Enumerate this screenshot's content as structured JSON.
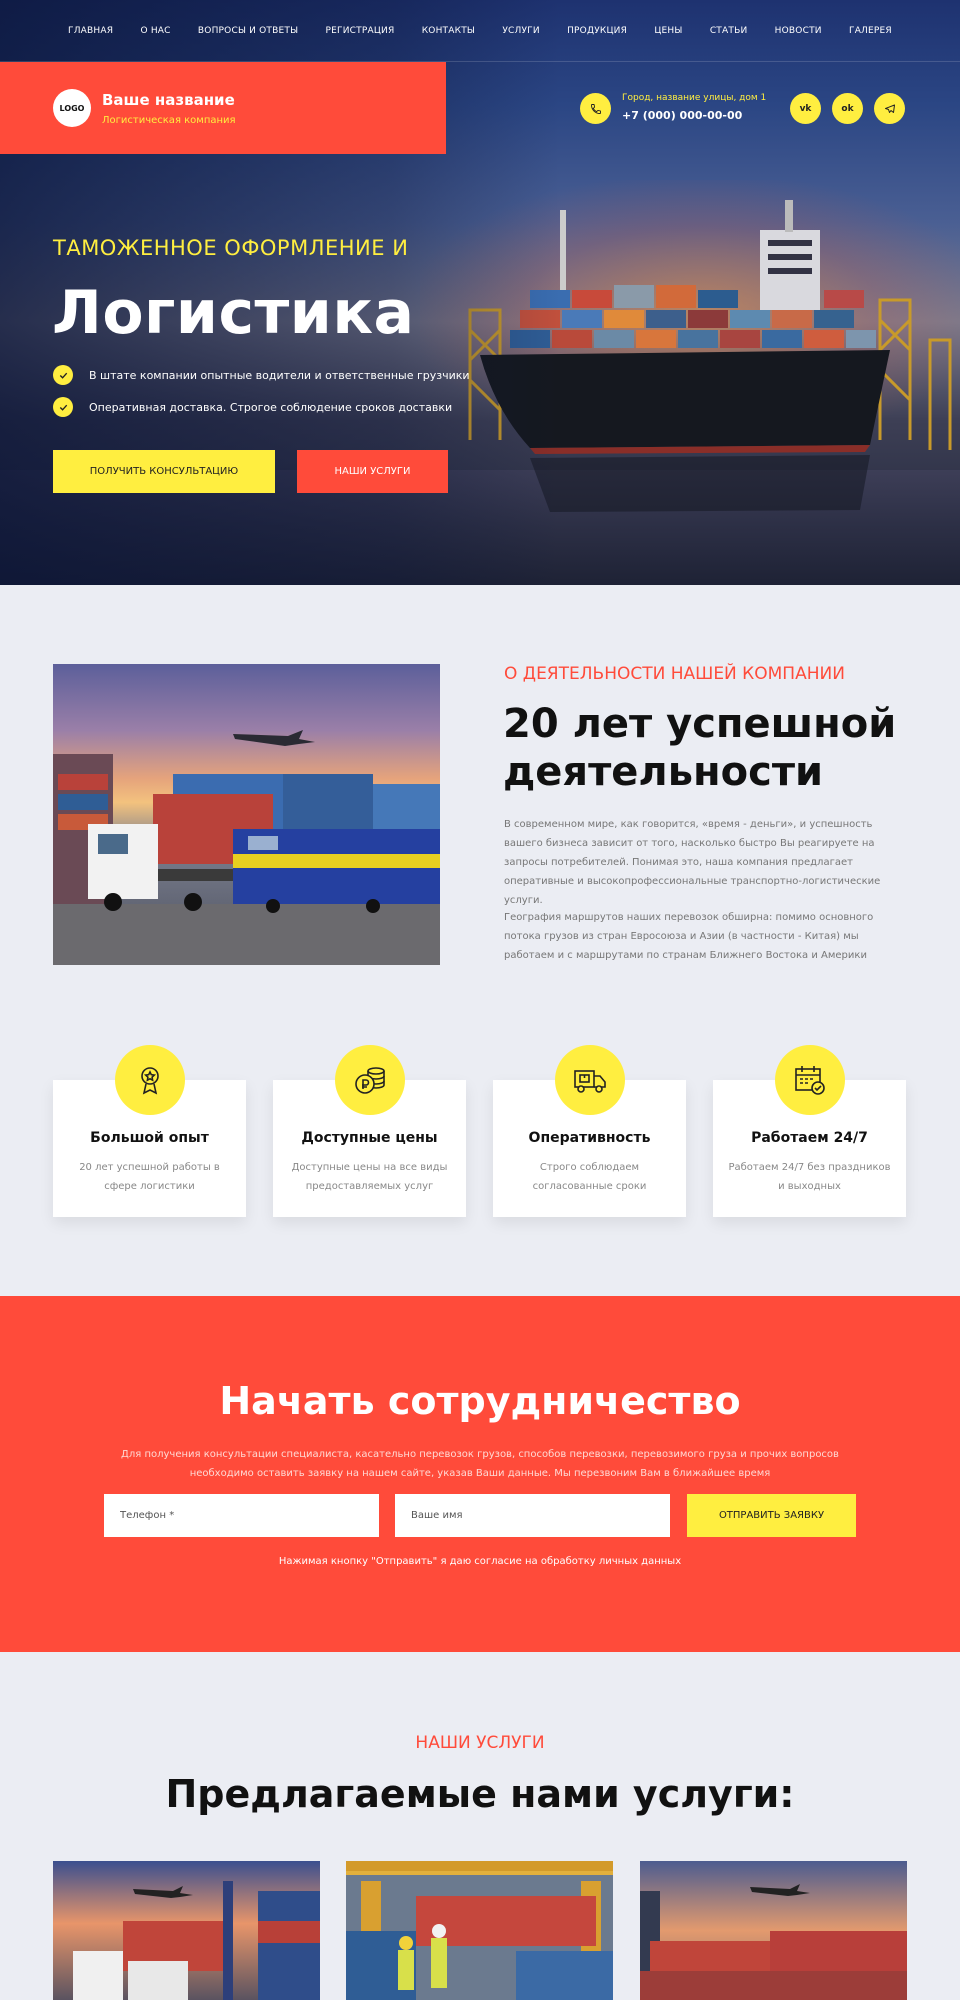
{
  "nav": {
    "items": [
      "ГЛАВНАЯ",
      "О НАС",
      "ВОПРОСЫ И ОТВЕТЫ",
      "РЕГИСТРАЦИЯ",
      "КОНТАКТЫ",
      "УСЛУГИ",
      "ПРОДУКЦИЯ",
      "ЦЕНЫ",
      "СТАТЬИ",
      "НОВОСТИ",
      "ГАЛЕРЕЯ"
    ]
  },
  "brand": {
    "logo": "LOGO",
    "name": "Ваше название",
    "subtitle": "Логистическая компания"
  },
  "contact": {
    "address": "Город, название улицы, дом 1",
    "phone": "+7 (000) 000-00-00",
    "phone_icon": "phone-icon",
    "social": [
      {
        "icon": "vk-icon",
        "glyph": "vk"
      },
      {
        "icon": "odnoklassniki-icon",
        "glyph": "ok"
      },
      {
        "icon": "telegram-icon",
        "glyph": "tg"
      }
    ]
  },
  "hero": {
    "kicker": "ТАМОЖЕННОЕ ОФОРМЛЕНИЕ И",
    "title": "Логистика",
    "bullets": [
      "В штате компании опытные водители и ответственные грузчики",
      "Оперативная доставка. Строгое соблюдение сроков доставки"
    ],
    "btn_consult": "ПОЛУЧИТЬ КОНСУЛЬТАЦИЮ",
    "btn_services": "НАШИ УСЛУГИ"
  },
  "about": {
    "kicker": "О ДЕЯТЕЛЬНОСТИ НАШЕЙ КОМПАНИИ",
    "title": "20 лет успешной деятельности",
    "p1": "В современном мире, как говорится, «время - деньги», и успешность вашего бизнеса зависит от того, насколько быстро Вы реагируете на запросы потребителей. Понимая это, наша компания предлагает оперативные и высокопрофессиональные транспортно-логистические услуги.",
    "p2": "География маршрутов наших перевозок обширна: помимо основного потока грузов из стран Евросоюза и Азии (в частности - Китая) мы работаем и с маршрутами по странам Ближнего Востока и Америки"
  },
  "features": [
    {
      "icon": "award-icon",
      "title": "Большой опыт",
      "text": "20 лет успешной работы в сфере логистики"
    },
    {
      "icon": "coins-icon",
      "title": "Доступные цены",
      "text": "Доступные цены на все виды предоставляемых услуг"
    },
    {
      "icon": "delivery-truck-icon",
      "title": "Оперативность",
      "text": "Строго соблюдаем согласованные сроки"
    },
    {
      "icon": "calendar-check-icon",
      "title": "Работаем 24/7",
      "text": "Работаем 24/7 без праздников и выходных"
    }
  ],
  "cta": {
    "title": "Начать сотрудничество",
    "description": "Для получения консультации специалиста, касательно перевозок грузов, способов перевозки, перевозимого груза и прочих вопросов необходимо оставить заявку на нашем сайте, указав Ваши данные. Мы перезвоним Вам в ближайшее время",
    "phone_placeholder": "Телефон *",
    "name_placeholder": "Ваше имя",
    "submit": "ОТПРАВИТЬ ЗАЯВКУ",
    "consent": "Нажимая кнопку \"Отправить\" я даю согласие на обработку личных данных"
  },
  "services": {
    "kicker": "НАШИ УСЛУГИ",
    "title": "Предлагаемые нами услуги:"
  },
  "colors": {
    "accent_red": "#ff4b3a",
    "accent_yellow": "#ffee40",
    "page_bg": "#ebedf3"
  }
}
